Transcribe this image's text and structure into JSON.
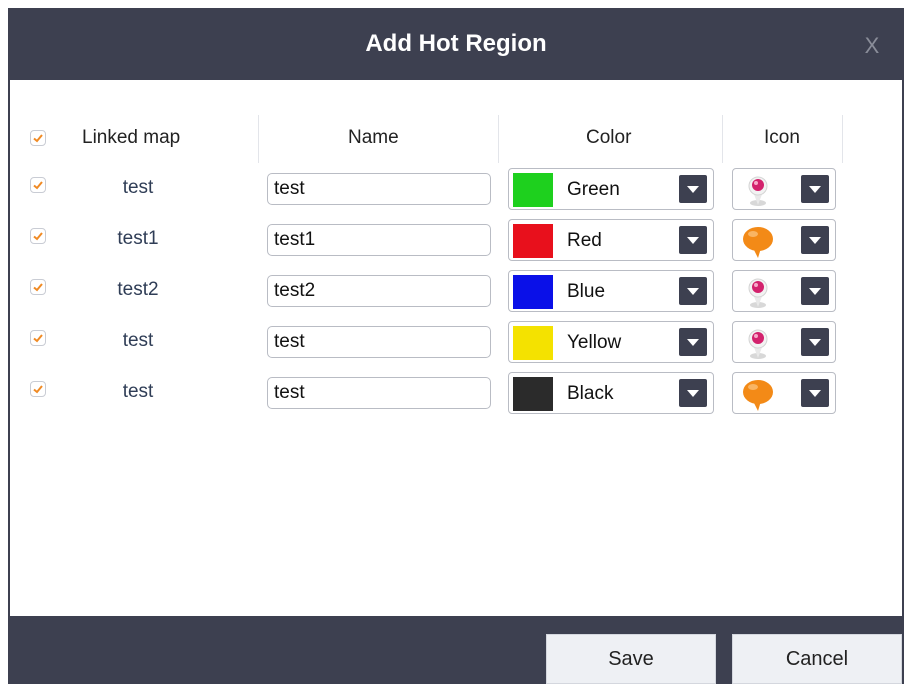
{
  "dialog": {
    "title": "Add Hot Region",
    "close_label": "X",
    "save_label": "Save",
    "cancel_label": "Cancel"
  },
  "table": {
    "headers": {
      "linked_map": "Linked map",
      "name": "Name",
      "color": "Color",
      "icon": "Icon"
    },
    "header_checked": true,
    "rows": [
      {
        "checked": true,
        "linked_map": "test",
        "name": "test",
        "color": "Green",
        "swatch": "#1ed01e",
        "icon": "pink-pin-icon"
      },
      {
        "checked": true,
        "linked_map": "test1",
        "name": "test1",
        "color": "Red",
        "swatch": "#e8101c",
        "icon": "orange-balloon-icon"
      },
      {
        "checked": true,
        "linked_map": "test2",
        "name": "test2",
        "color": "Blue",
        "swatch": "#0a10e8",
        "icon": "pink-pin-icon"
      },
      {
        "checked": true,
        "linked_map": "test",
        "name": "test",
        "color": "Yellow",
        "swatch": "#f4e200",
        "icon": "pink-pin-icon"
      },
      {
        "checked": true,
        "linked_map": "test",
        "name": "test",
        "color": "Black",
        "swatch": "#2b2b2b",
        "icon": "orange-balloon-icon"
      }
    ]
  },
  "colors": {
    "chrome": "#3d4050",
    "check": "#f08a24",
    "link_text": "#2f3d56"
  }
}
